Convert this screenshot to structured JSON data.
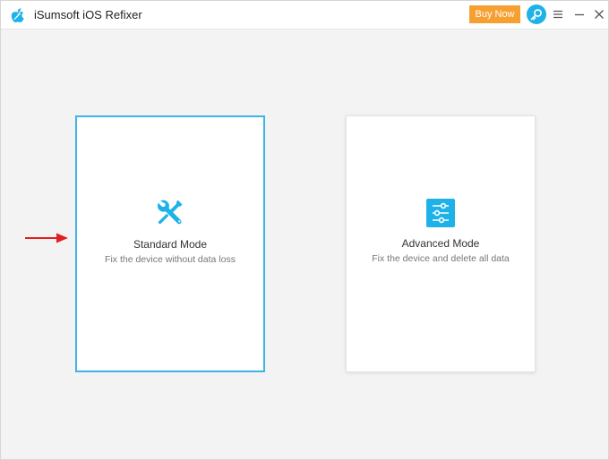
{
  "app": {
    "title": "iSumsoft iOS Refixer",
    "icon": "apple-wrench-logo"
  },
  "header": {
    "buy_label": "Buy Now",
    "key_icon": "key-icon",
    "menu_icon": "hamburger-icon",
    "minimize_icon": "minimize-icon",
    "close_icon": "close-icon"
  },
  "modes": [
    {
      "title": "Standard Mode",
      "description": "Fix the device without data loss",
      "icon": "tools-icon",
      "selected": true
    },
    {
      "title": "Advanced Mode",
      "description": "Fix the device and delete all data",
      "icon": "sliders-icon",
      "selected": false
    }
  ],
  "colors": {
    "accent": "#1fb2e8",
    "buy_button": "#f7a032",
    "arrow": "#e02020",
    "selected_border": "#3fb2ea"
  }
}
